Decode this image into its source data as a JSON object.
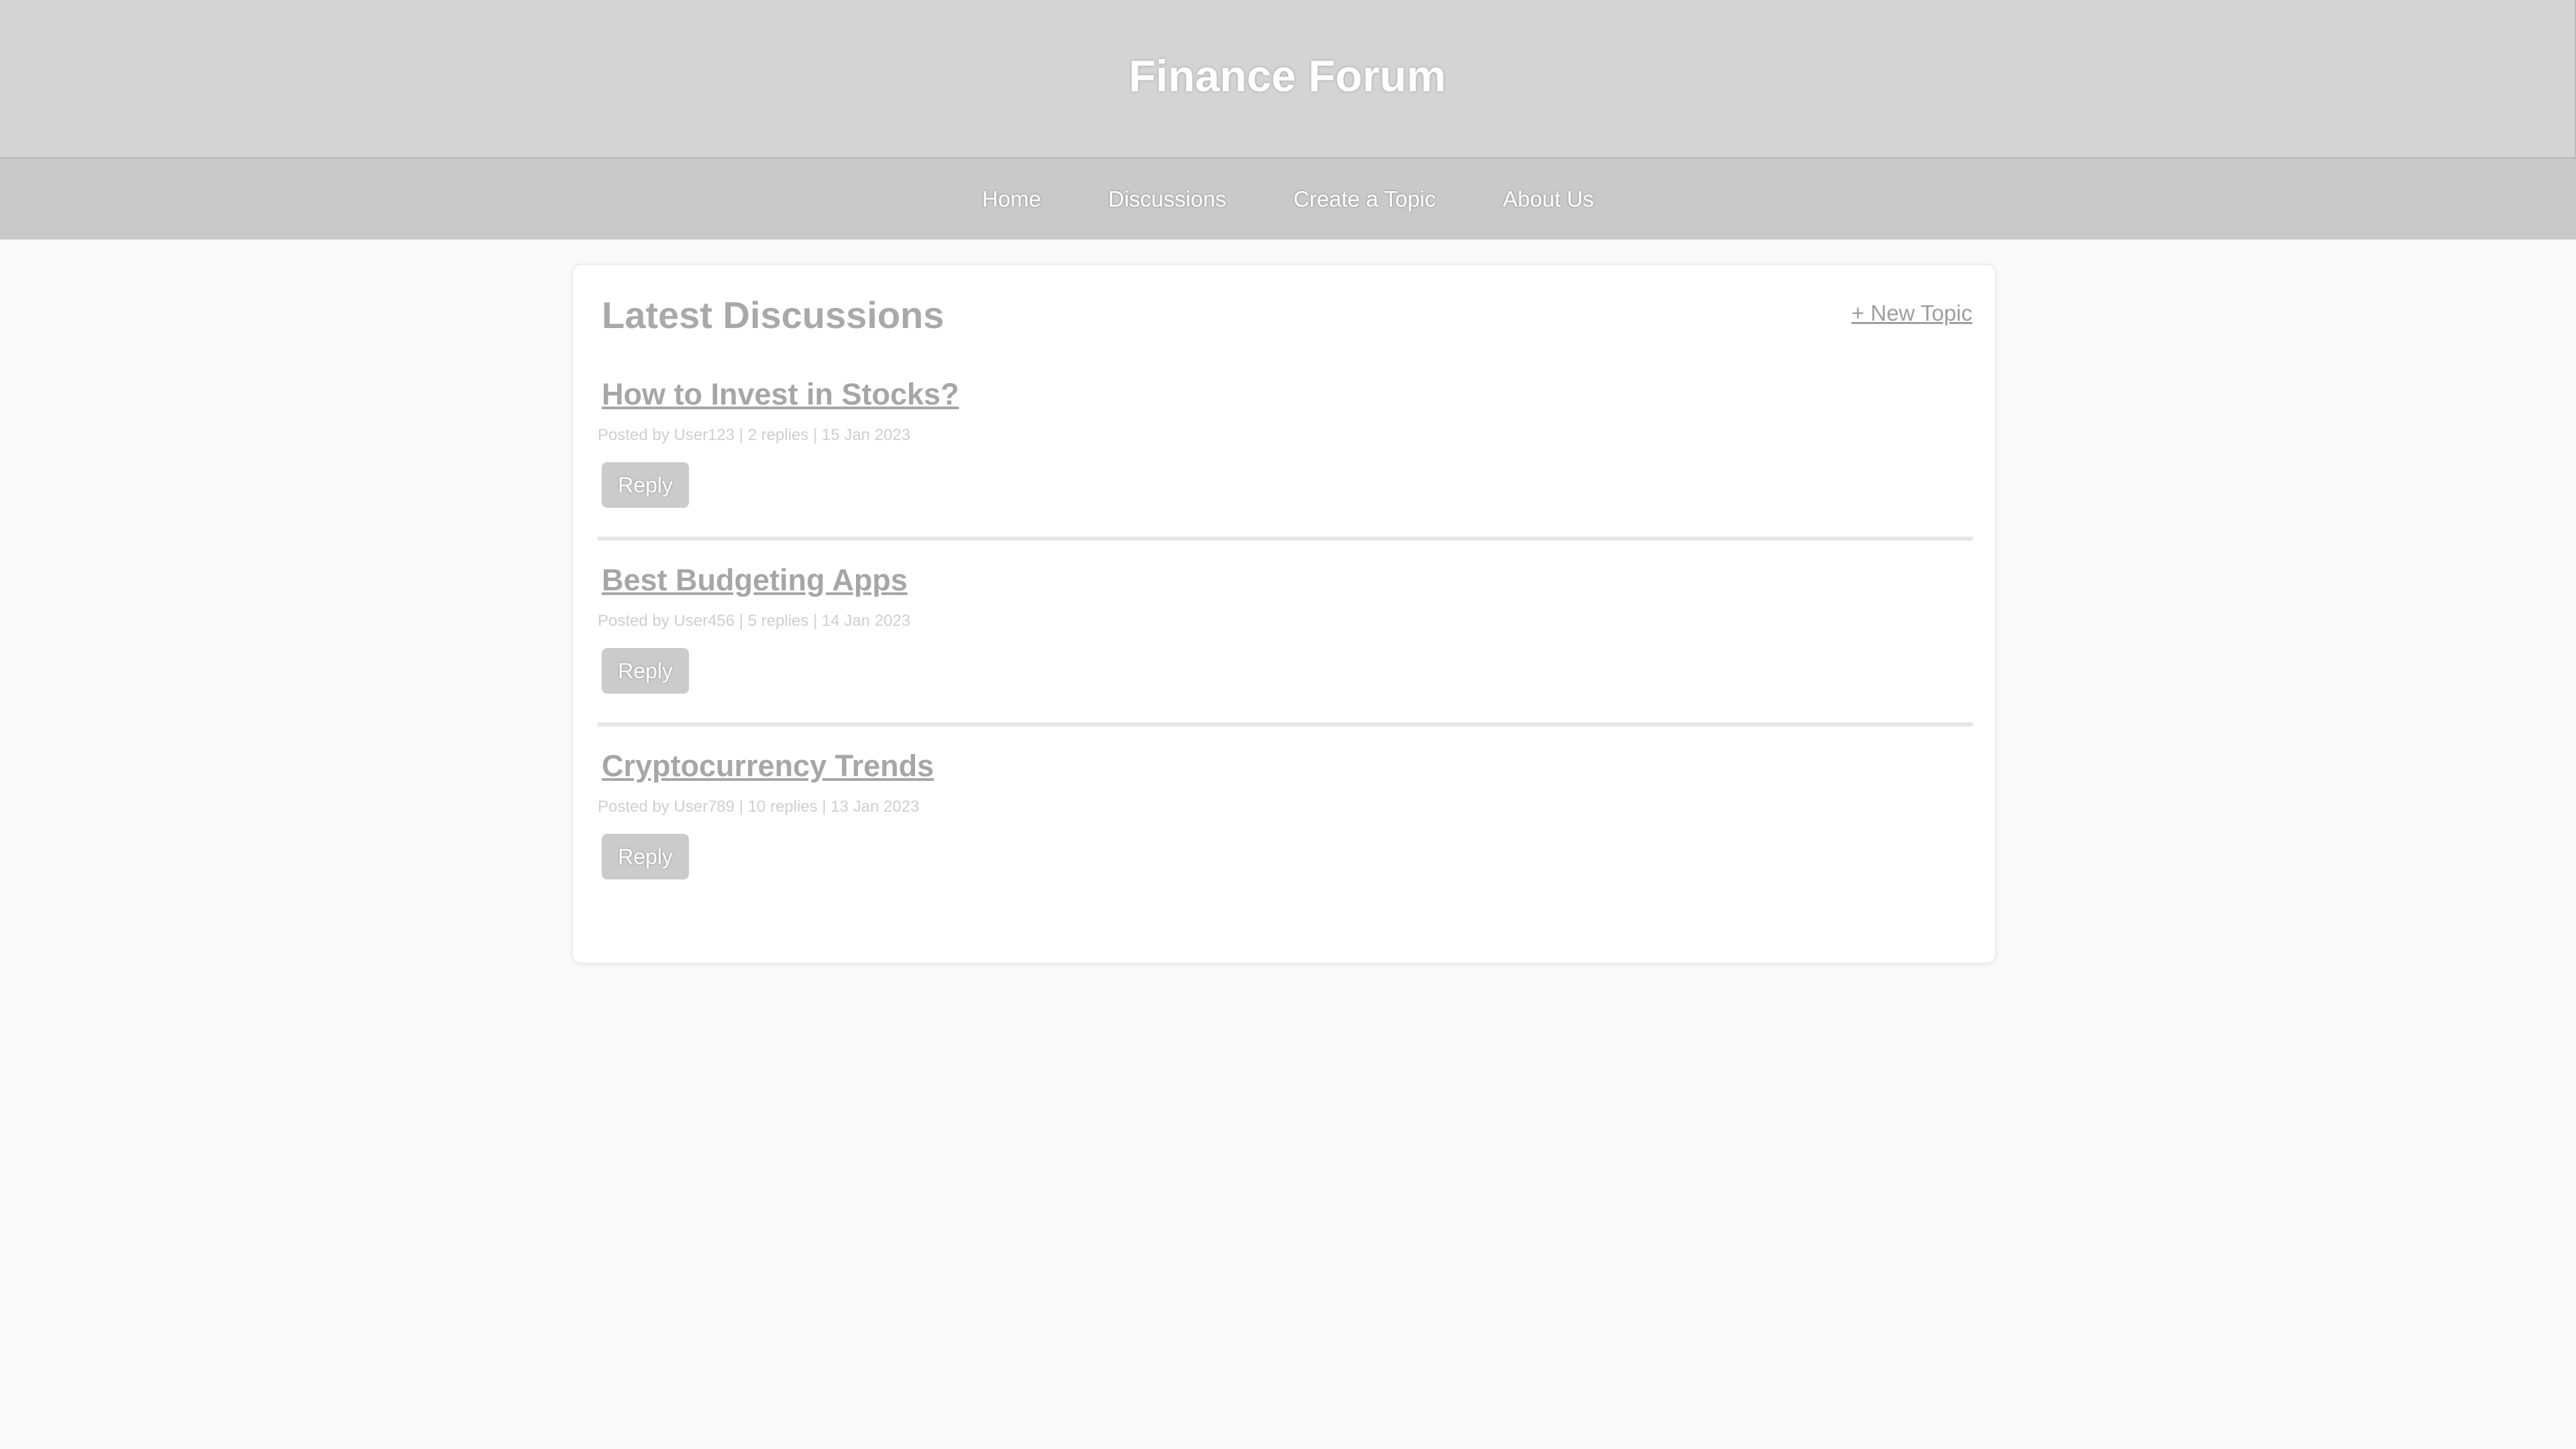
{
  "header": {
    "title": "Finance Forum"
  },
  "nav": {
    "items": [
      {
        "label": "Home"
      },
      {
        "label": "Discussions"
      },
      {
        "label": "Create a Topic"
      },
      {
        "label": "About Us"
      }
    ]
  },
  "main": {
    "heading": "Latest Discussions",
    "new_topic_label": "+ New Topic",
    "topics": [
      {
        "title": "How to Invest in Stocks?",
        "meta": "Posted by User123 | 2 replies | 15 Jan 2023",
        "reply_label": "Reply"
      },
      {
        "title": "Best Budgeting Apps",
        "meta": "Posted by User456 | 5 replies | 14 Jan 2023",
        "reply_label": "Reply"
      },
      {
        "title": "Cryptocurrency Trends",
        "meta": "Posted by User789 | 10 replies | 13 Jan 2023",
        "reply_label": "Reply"
      }
    ]
  },
  "colors": {
    "header_bg": "#d4d4d4",
    "nav_bg": "#c9c9c9",
    "page_bg": "#fafafa",
    "button_bg": "#cbcbcb"
  }
}
